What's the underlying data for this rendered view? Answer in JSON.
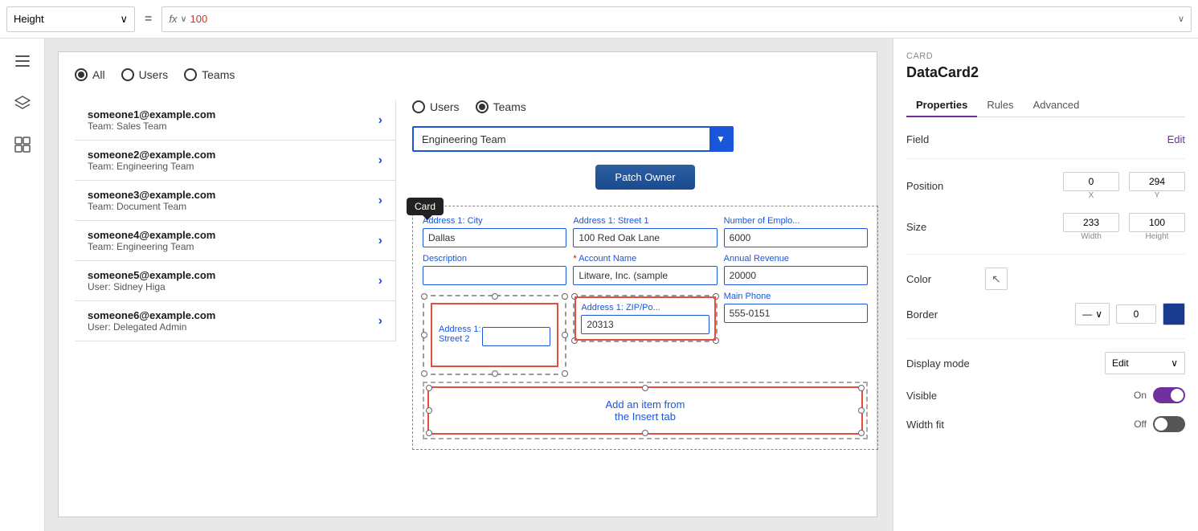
{
  "topbar": {
    "height_label": "Height",
    "equals_sign": "=",
    "fx_label": "fx",
    "fx_value": "100",
    "expand_icon": "∨"
  },
  "sidebar": {
    "icons": [
      "menu",
      "layers",
      "components"
    ]
  },
  "canvas": {
    "radio_group_top": {
      "options": [
        {
          "label": "All",
          "checked": true
        },
        {
          "label": "Users",
          "checked": false
        },
        {
          "label": "Teams",
          "checked": false
        }
      ]
    },
    "users": [
      {
        "email": "someone1@example.com",
        "team": "Team: Sales Team"
      },
      {
        "email": "someone2@example.com",
        "team": "Team: Engineering Team"
      },
      {
        "email": "someone3@example.com",
        "team": "Team: Document Team"
      },
      {
        "email": "someone4@example.com",
        "team": "Team: Engineering Team"
      },
      {
        "email": "someone5@example.com",
        "team": "User: Sidney Higa"
      },
      {
        "email": "someone6@example.com",
        "team": "User: Delegated Admin"
      }
    ],
    "form": {
      "radio_group": {
        "options": [
          {
            "label": "Users",
            "checked": false
          },
          {
            "label": "Teams",
            "checked": true
          }
        ]
      },
      "dropdown_value": "Engineering Team",
      "dropdown_arrow": "▼",
      "patch_owner_btn": "Patch Owner",
      "card_tooltip": "Card",
      "add_item_text": "Add an item from\nthe Insert tab",
      "grid_fields": [
        [
          {
            "label": "Address 1: City",
            "value": "Dallas",
            "required": false
          },
          {
            "label": "Address 1: Street 1",
            "value": "100 Red Oak Lane",
            "required": false
          },
          {
            "label": "Number of Emplo...",
            "value": "6000",
            "required": false
          }
        ],
        [
          {
            "label": "Description",
            "value": "",
            "required": false
          },
          {
            "label": "Account Name",
            "value": "Litware, Inc. (sample",
            "required": true
          },
          {
            "label": "Annual Revenue",
            "value": "20000",
            "required": false
          }
        ],
        [
          {
            "label": "Address 1: Street 2",
            "value": "",
            "required": false
          },
          {
            "label": "Address 1: ZIP/Po...",
            "value": "20313",
            "required": false
          },
          {
            "label": "Main Phone",
            "value": "555-0151",
            "required": false
          }
        ]
      ]
    }
  },
  "properties": {
    "card_section_label": "CARD",
    "card_name": "DataCard2",
    "tabs": [
      "Properties",
      "Rules",
      "Advanced"
    ],
    "active_tab": "Properties",
    "field_label": "Field",
    "field_edit": "Edit",
    "position_label": "Position",
    "position_x": "0",
    "position_y": "294",
    "position_x_label": "X",
    "position_y_label": "Y",
    "size_label": "Size",
    "size_width": "233",
    "size_height": "100",
    "size_width_label": "Width",
    "size_height_label": "Height",
    "color_label": "Color",
    "color_icon": "↖",
    "border_label": "Border",
    "border_value": "0",
    "border_color": "#1a3a8f",
    "display_mode_label": "Display mode",
    "display_mode_value": "Edit",
    "visible_label": "Visible",
    "visible_on_label": "On",
    "width_fit_label": "Width fit",
    "width_fit_off_label": "Off"
  }
}
